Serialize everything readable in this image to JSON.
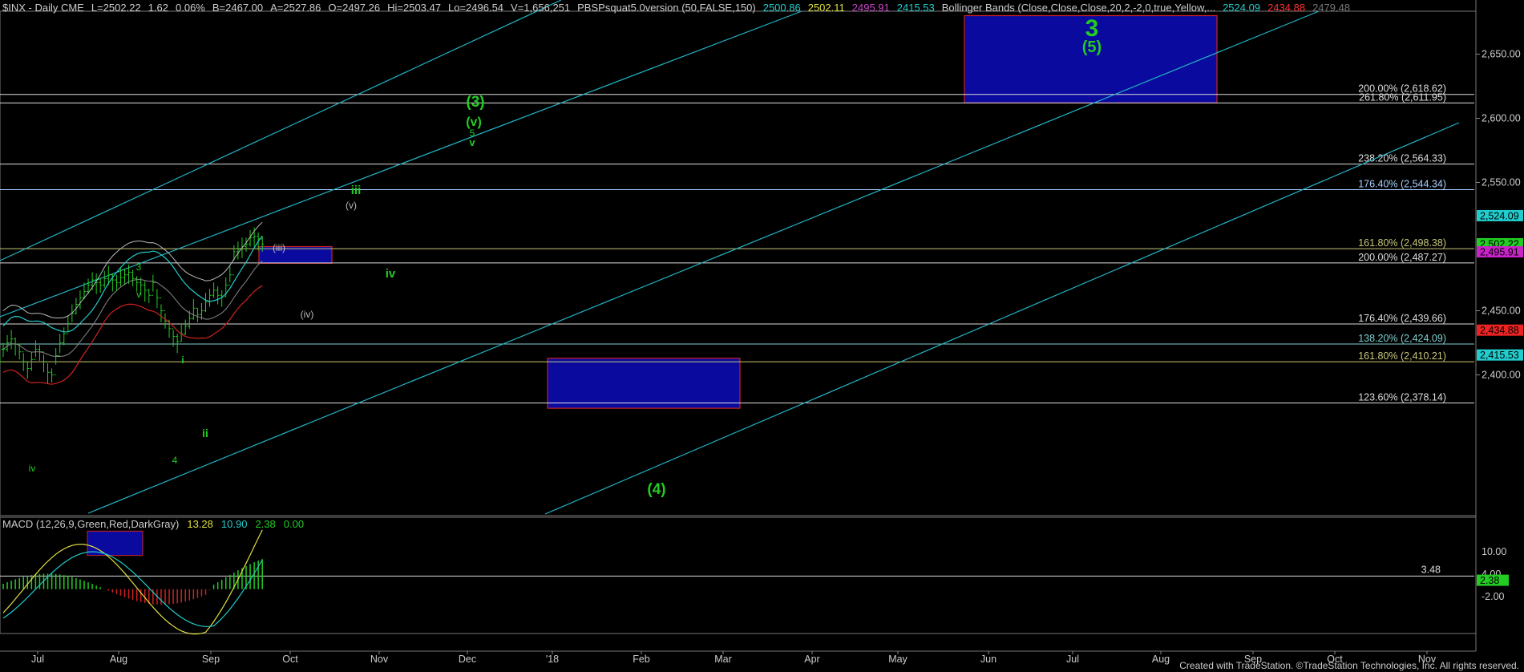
{
  "header": {
    "symbol_text": "$INX - Daily CME",
    "last": "L=2502.22",
    "change": "1.62",
    "change_pct": "0.06%",
    "bid": "B=2467.00",
    "ask": "A=2527.86",
    "open": "O=2497.26",
    "high": "Hi=2503.47",
    "low": "Lo=2496.54",
    "volume": "V=1,656,251",
    "study1_name": "PBSPsquat5.0version (50,FALSE,150)",
    "study1_values": [
      "2500.86",
      "2502.11",
      "2495.91",
      "2415.53"
    ],
    "study1_colors": [
      "#22cccc",
      "#e0e040",
      "#cc44cc",
      "#22cccc"
    ],
    "study2_name": "Bollinger Bands (Close,Close,Close,20,2,-2,0,true,Yellow,...",
    "study2_values": [
      "2524.09",
      "2434.88",
      "2479.48"
    ],
    "study2_colors": [
      "#22cccc",
      "#ff3030",
      "#777777"
    ]
  },
  "macd_header": {
    "name": "MACD (12,26,9,Green,Red,DarkGray)",
    "values": [
      "13.28",
      "10.90",
      "2.38",
      "0.00"
    ],
    "colors": [
      "#e0e040",
      "#22cccc",
      "#22cc22",
      "#22cc22"
    ]
  },
  "footer": "Created with TradeStation. ©TradeStation Technologies, Inc. All rights reserved.",
  "chart_data": {
    "type": "line",
    "symbol": "$INX",
    "interval": "Daily",
    "ylim": [
      2365,
      2690
    ],
    "y_ticks": [
      "2,650.00",
      "2,600.00",
      "2,550.00",
      "2,450.00",
      "2,400.00"
    ],
    "y_tick_values": [
      2650,
      2600,
      2550,
      2450,
      2400
    ],
    "x_ticks": [
      "Jul",
      "Aug",
      "Sep",
      "Oct",
      "Nov",
      "Dec",
      "'18",
      "Feb",
      "Mar",
      "Apr",
      "May",
      "Jun",
      "Jul",
      "Aug",
      "Sep",
      "Oct",
      "Nov"
    ],
    "fib_levels": [
      {
        "label": "200.00% (2,618.62)",
        "value": 2618.62,
        "color": "#dddddd"
      },
      {
        "label": "261.80% (2,611.95)",
        "value": 2611.95,
        "color": "#dddddd"
      },
      {
        "label": "238.20% (2,564.33)",
        "value": 2564.33,
        "color": "#dddddd"
      },
      {
        "label": "176.40% (2,544.34)",
        "value": 2544.34,
        "color": "#a8d0ff"
      },
      {
        "label": "161.80% (2,498.38)",
        "value": 2498.38,
        "color": "#c8c87a"
      },
      {
        "label": "200.00% (2,487.27)",
        "value": 2487.27,
        "color": "#dddddd"
      },
      {
        "label": "176.40% (2,439.66)",
        "value": 2439.66,
        "color": "#dddddd"
      },
      {
        "label": "138.20% (2,424.09)",
        "value": 2424.09,
        "color": "#7fd0d0"
      },
      {
        "label": "161.80% (2,410.21)",
        "value": 2410.21,
        "color": "#c8c87a"
      },
      {
        "label": "123.60% (2,378.14)",
        "value": 2378.14,
        "color": "#dddddd"
      }
    ],
    "price_badges": [
      {
        "value": 2524.09,
        "text": "2,524.09",
        "bg": "#22cccc",
        "fg": "#000000"
      },
      {
        "value": 2502.22,
        "text": "2,502.22",
        "bg": "#22cc22",
        "fg": "#000000"
      },
      {
        "value": 2495.91,
        "text": "2,495.91",
        "bg": "#cc22cc",
        "fg": "#000000"
      },
      {
        "value": 2434.88,
        "text": "2,434.88",
        "bg": "#ee2222",
        "fg": "#000000"
      },
      {
        "value": 2415.53,
        "text": "2,415.53",
        "bg": "#22cccc",
        "fg": "#000000"
      }
    ],
    "target_boxes": [
      {
        "name": "wave-5-target-box",
        "label": "(5)",
        "top": 2680,
        "bottom": 2612
      },
      {
        "name": "wave-iv-target-box",
        "label": "(iv)",
        "top": 2500,
        "bottom": 2487
      },
      {
        "name": "wave-4-target-box",
        "label": "(4)",
        "top": 2413,
        "bottom": 2374
      }
    ],
    "wave_labels": [
      "3",
      "(5)",
      "(3)",
      "(v)",
      "5",
      "v",
      "iii",
      "(v)",
      "(iii)",
      "iv",
      "(iv)",
      "3",
      "v",
      "i",
      "ii",
      "4",
      "iv",
      "i",
      "(4)"
    ],
    "macd": {
      "y_ticks": [
        "10.00",
        "4.00",
        "-2.00"
      ],
      "y_tick_values": [
        10,
        4,
        -2
      ],
      "ylim": [
        -8,
        20
      ],
      "level_label": "3.48",
      "level_value": 3.48,
      "badge_text": "2.38",
      "badge_value": 2.38
    }
  }
}
